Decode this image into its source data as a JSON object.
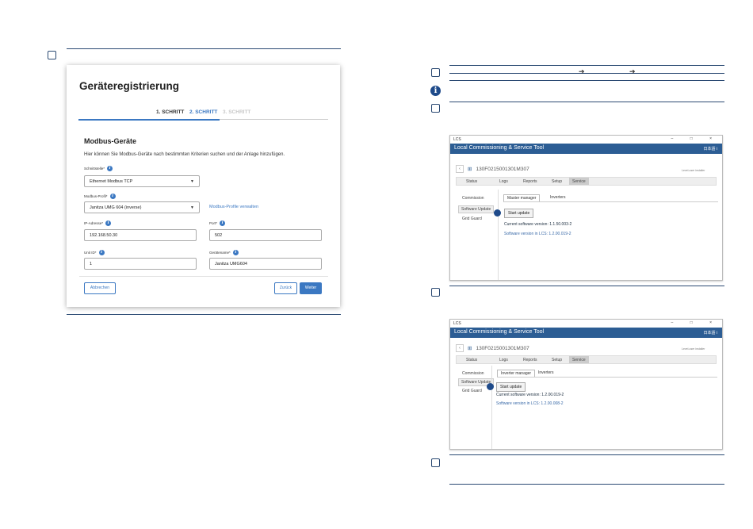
{
  "registration": {
    "title": "Geräteregistrierung",
    "steps": [
      "1. SCHRITT",
      "2. SCHRITT",
      "3. SCHRITT"
    ],
    "section_title": "Modbus-Geräte",
    "description": "Hier können Sie Modbus-Geräte nach bestimmten Kriterien suchen und der Anlage hinzufügen.",
    "interface_label": "Schnittstelle*",
    "interface_value": "Ethernet Modbus TCP",
    "profile_label": "Modbus-Profil*",
    "profile_value": "Janitza UMG 604 (inverse)",
    "profile_link": "Modbus-Profile verwalten",
    "ip_label": "IP-Adresse*",
    "ip_value": "192.168.50.30",
    "port_label": "Port*",
    "port_value": "502",
    "unit_label": "Unit ID*",
    "unit_value": "1",
    "name_label": "Gerätename*",
    "name_value": "Janitza UMG604",
    "cancel": "Abbrechen",
    "back": "Zurück",
    "next": "Weiter",
    "info_glyph": "i"
  },
  "lcs1": {
    "window_title": "LCS",
    "ctrls": "– □ ×",
    "app_title": "Local Commissioning & Service Tool",
    "appbar_right": "日本語   i",
    "back_glyph": "‹",
    "device": "130F0215001301M307",
    "tabs": [
      "Status",
      "Logs",
      "Reports",
      "Setup",
      "Service"
    ],
    "side": [
      "Commission",
      "Software Update",
      "Grid Guard"
    ],
    "subtabs": [
      "Master manager",
      "Inverters"
    ],
    "start": "Start update",
    "current_version": "Current software version: 1.1.50.003-2",
    "lcs_version": "Software version in LCS: 1.2.00.019-2",
    "login_note": "Level-user installer"
  },
  "lcs2": {
    "window_title": "LCS",
    "ctrls": "– □ ×",
    "app_title": "Local Commissioning & Service Tool",
    "appbar_right": "日本語   i",
    "back_glyph": "‹",
    "device": "130F0215001301M307",
    "tabs": [
      "Status",
      "Logs",
      "Reports",
      "Setup",
      "Service"
    ],
    "side": [
      "Commission",
      "Software Update",
      "Grid Guard"
    ],
    "subtabs": [
      "Inverter manager",
      "Inverters"
    ],
    "start": "Start update",
    "current_version": "Current software version: 1.2.00.019-2",
    "lcs_version": "Software version in LCS: 1.2.00.008-2",
    "login_note": "Level-user installer"
  },
  "colors": {
    "accent": "#3b78c2",
    "rule": "#2b4a73",
    "appbar": "#2c5d94"
  },
  "icons": [
    "checkbox-icon",
    "info-icon",
    "arrow-right-icon",
    "hint-icon",
    "caret-down-icon",
    "network-icon",
    "eye-icon",
    "log-icon",
    "report-icon",
    "gear-icon",
    "wrench-icon",
    "marker-icon"
  ]
}
